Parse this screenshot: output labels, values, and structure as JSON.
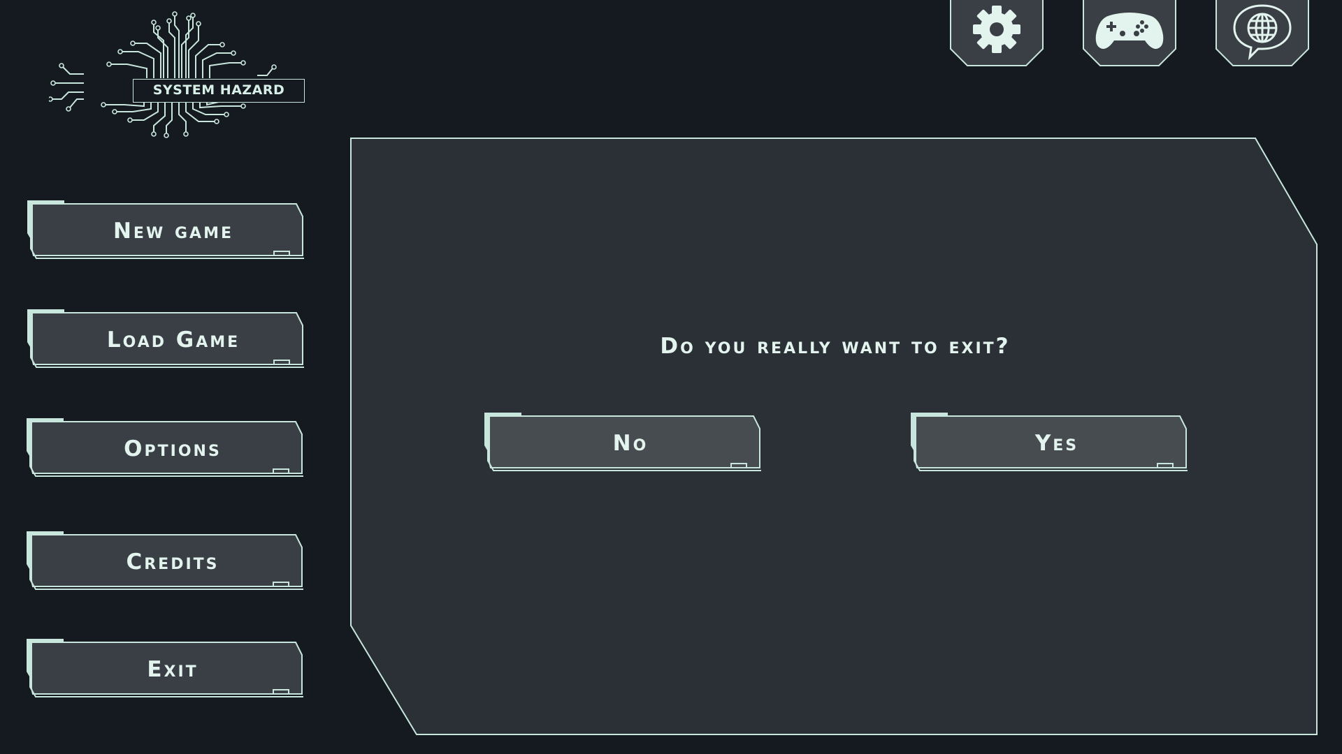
{
  "logo": {
    "text": "SYSTEM HAZARD"
  },
  "top_icons": [
    {
      "name": "settings",
      "icon": "gear-icon"
    },
    {
      "name": "controller",
      "icon": "gamepad-icon"
    },
    {
      "name": "language",
      "icon": "globe-speech-icon"
    }
  ],
  "menu": {
    "items": [
      {
        "label": "New game"
      },
      {
        "label": "Load Game"
      },
      {
        "label": "Options"
      },
      {
        "label": "Credits"
      },
      {
        "label": "Exit"
      }
    ]
  },
  "dialog": {
    "question": "Do you really want to exit?",
    "no_label": "No",
    "yes_label": "Yes"
  },
  "colors": {
    "background": "#151a21",
    "panel": "#2b3037",
    "button_fill": "#3a3f45",
    "dialog_button_fill": "#464c50",
    "accent": "#c9e6dc",
    "text": "#e3f3ed"
  }
}
